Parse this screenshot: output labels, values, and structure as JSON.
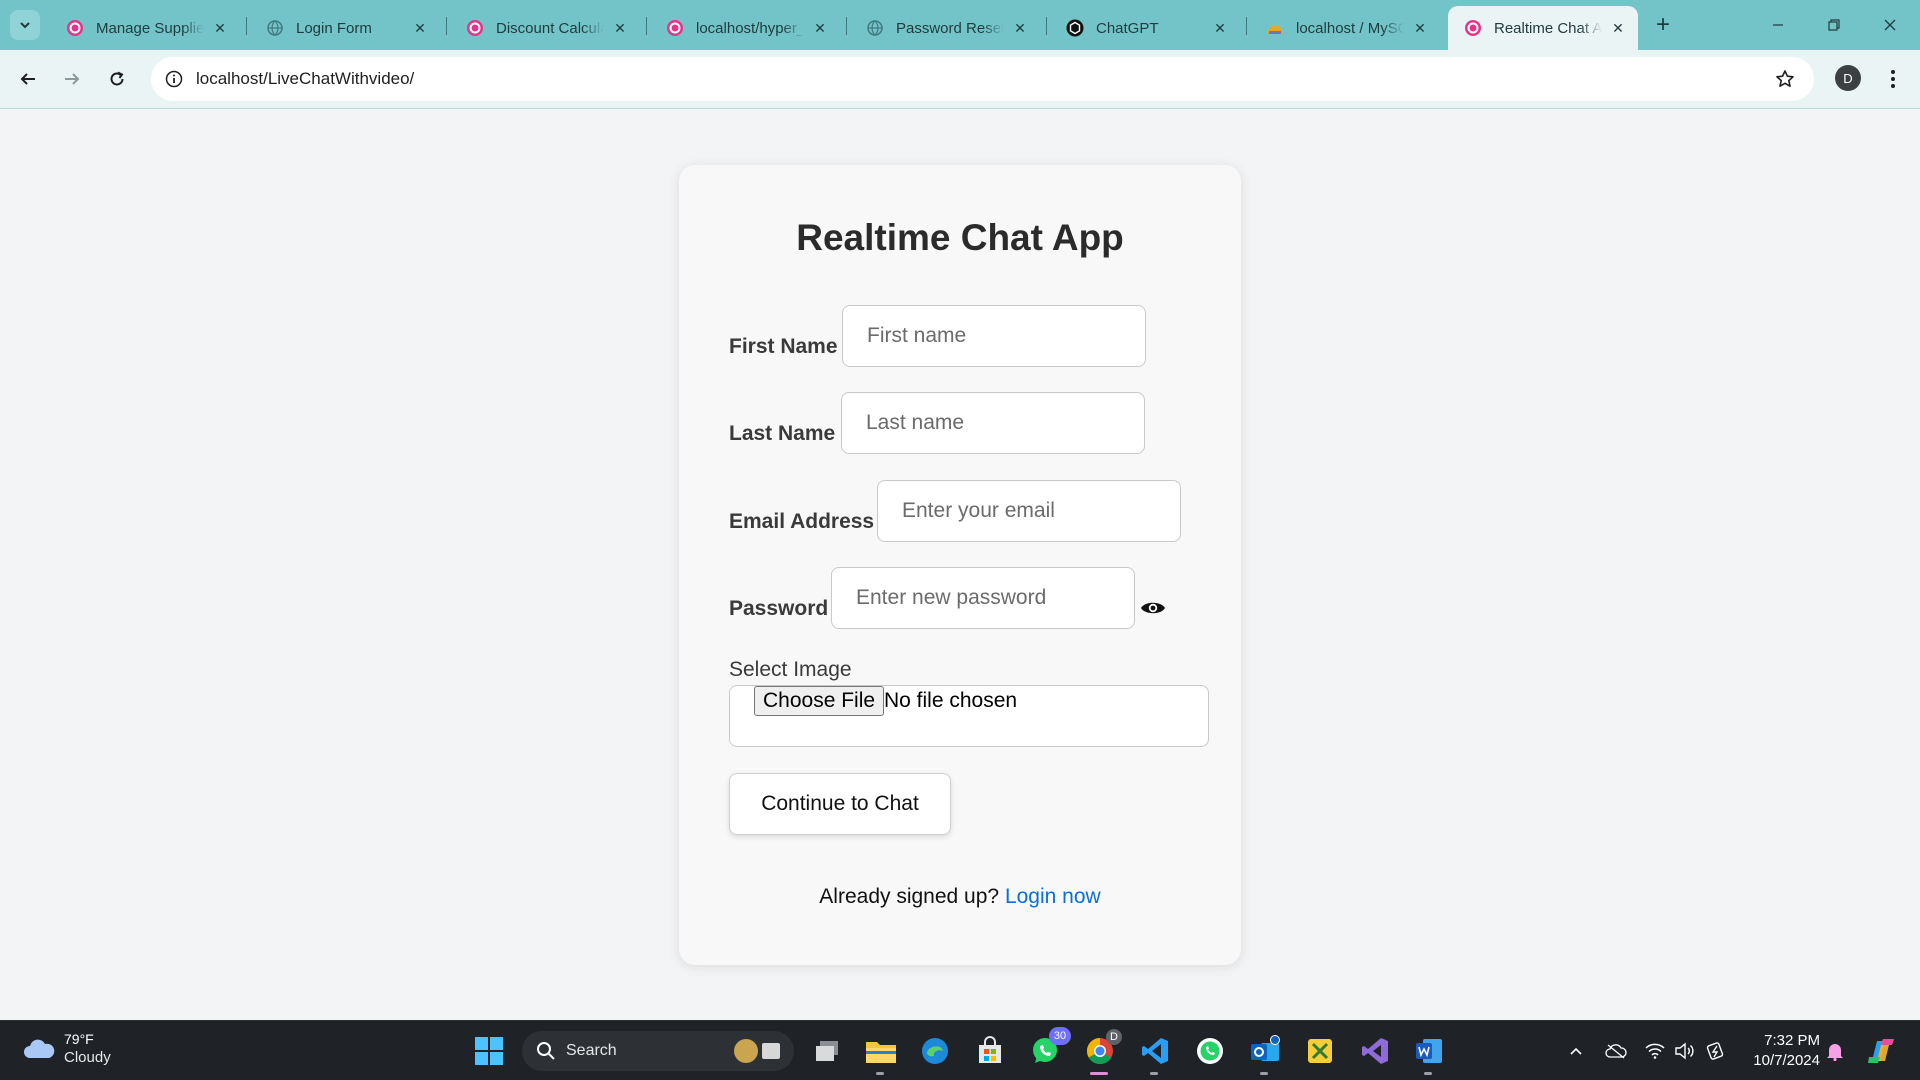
{
  "browser": {
    "tabs": [
      {
        "title": "Manage Supplie",
        "favicon": "php-project-icon",
        "active": false
      },
      {
        "title": "Login Form",
        "favicon": "globe-icon",
        "active": false
      },
      {
        "title": "Discount Calcula",
        "favicon": "php-project-icon",
        "active": false
      },
      {
        "title": "localhost/hyper_",
        "favicon": "php-project-icon",
        "active": false
      },
      {
        "title": "Password Reset F",
        "favicon": "globe-icon",
        "active": false
      },
      {
        "title": "ChatGPT",
        "favicon": "chatgpt-icon",
        "active": false
      },
      {
        "title": "localhost / MySQ",
        "favicon": "phpmyadmin-icon",
        "active": false
      },
      {
        "title": "Realtime Chat Ap",
        "favicon": "php-project-icon",
        "active": true
      }
    ],
    "close_glyph": "✕",
    "new_tab_glyph": "+",
    "url": "localhost/LiveChatWithvideo/",
    "profile_initial": "D"
  },
  "form": {
    "title": "Realtime Chat App",
    "first_name": {
      "label": "First Name",
      "placeholder": "First name"
    },
    "last_name": {
      "label": "Last Name",
      "placeholder": "Last name"
    },
    "email": {
      "label": "Email Address",
      "placeholder": "Enter your email"
    },
    "password": {
      "label": "Password",
      "placeholder": "Enter new password"
    },
    "image": {
      "label": "Select Image",
      "button": "Choose File",
      "status": "No file chosen"
    },
    "submit": "Continue to Chat",
    "footer_text": "Already signed up?",
    "footer_link": "Login now"
  },
  "taskbar": {
    "weather_temp": "79°F",
    "weather_cond": "Cloudy",
    "search_label": "Search",
    "whatsapp_badge": "30",
    "chrome_badge": "D",
    "time": "7:32 PM",
    "date": "10/7/2024"
  },
  "colors": {
    "tabstrip": "#73c4c9",
    "toolbar": "#eaf4f5",
    "link": "#0d6edb",
    "taskbar": "#1f2226"
  }
}
